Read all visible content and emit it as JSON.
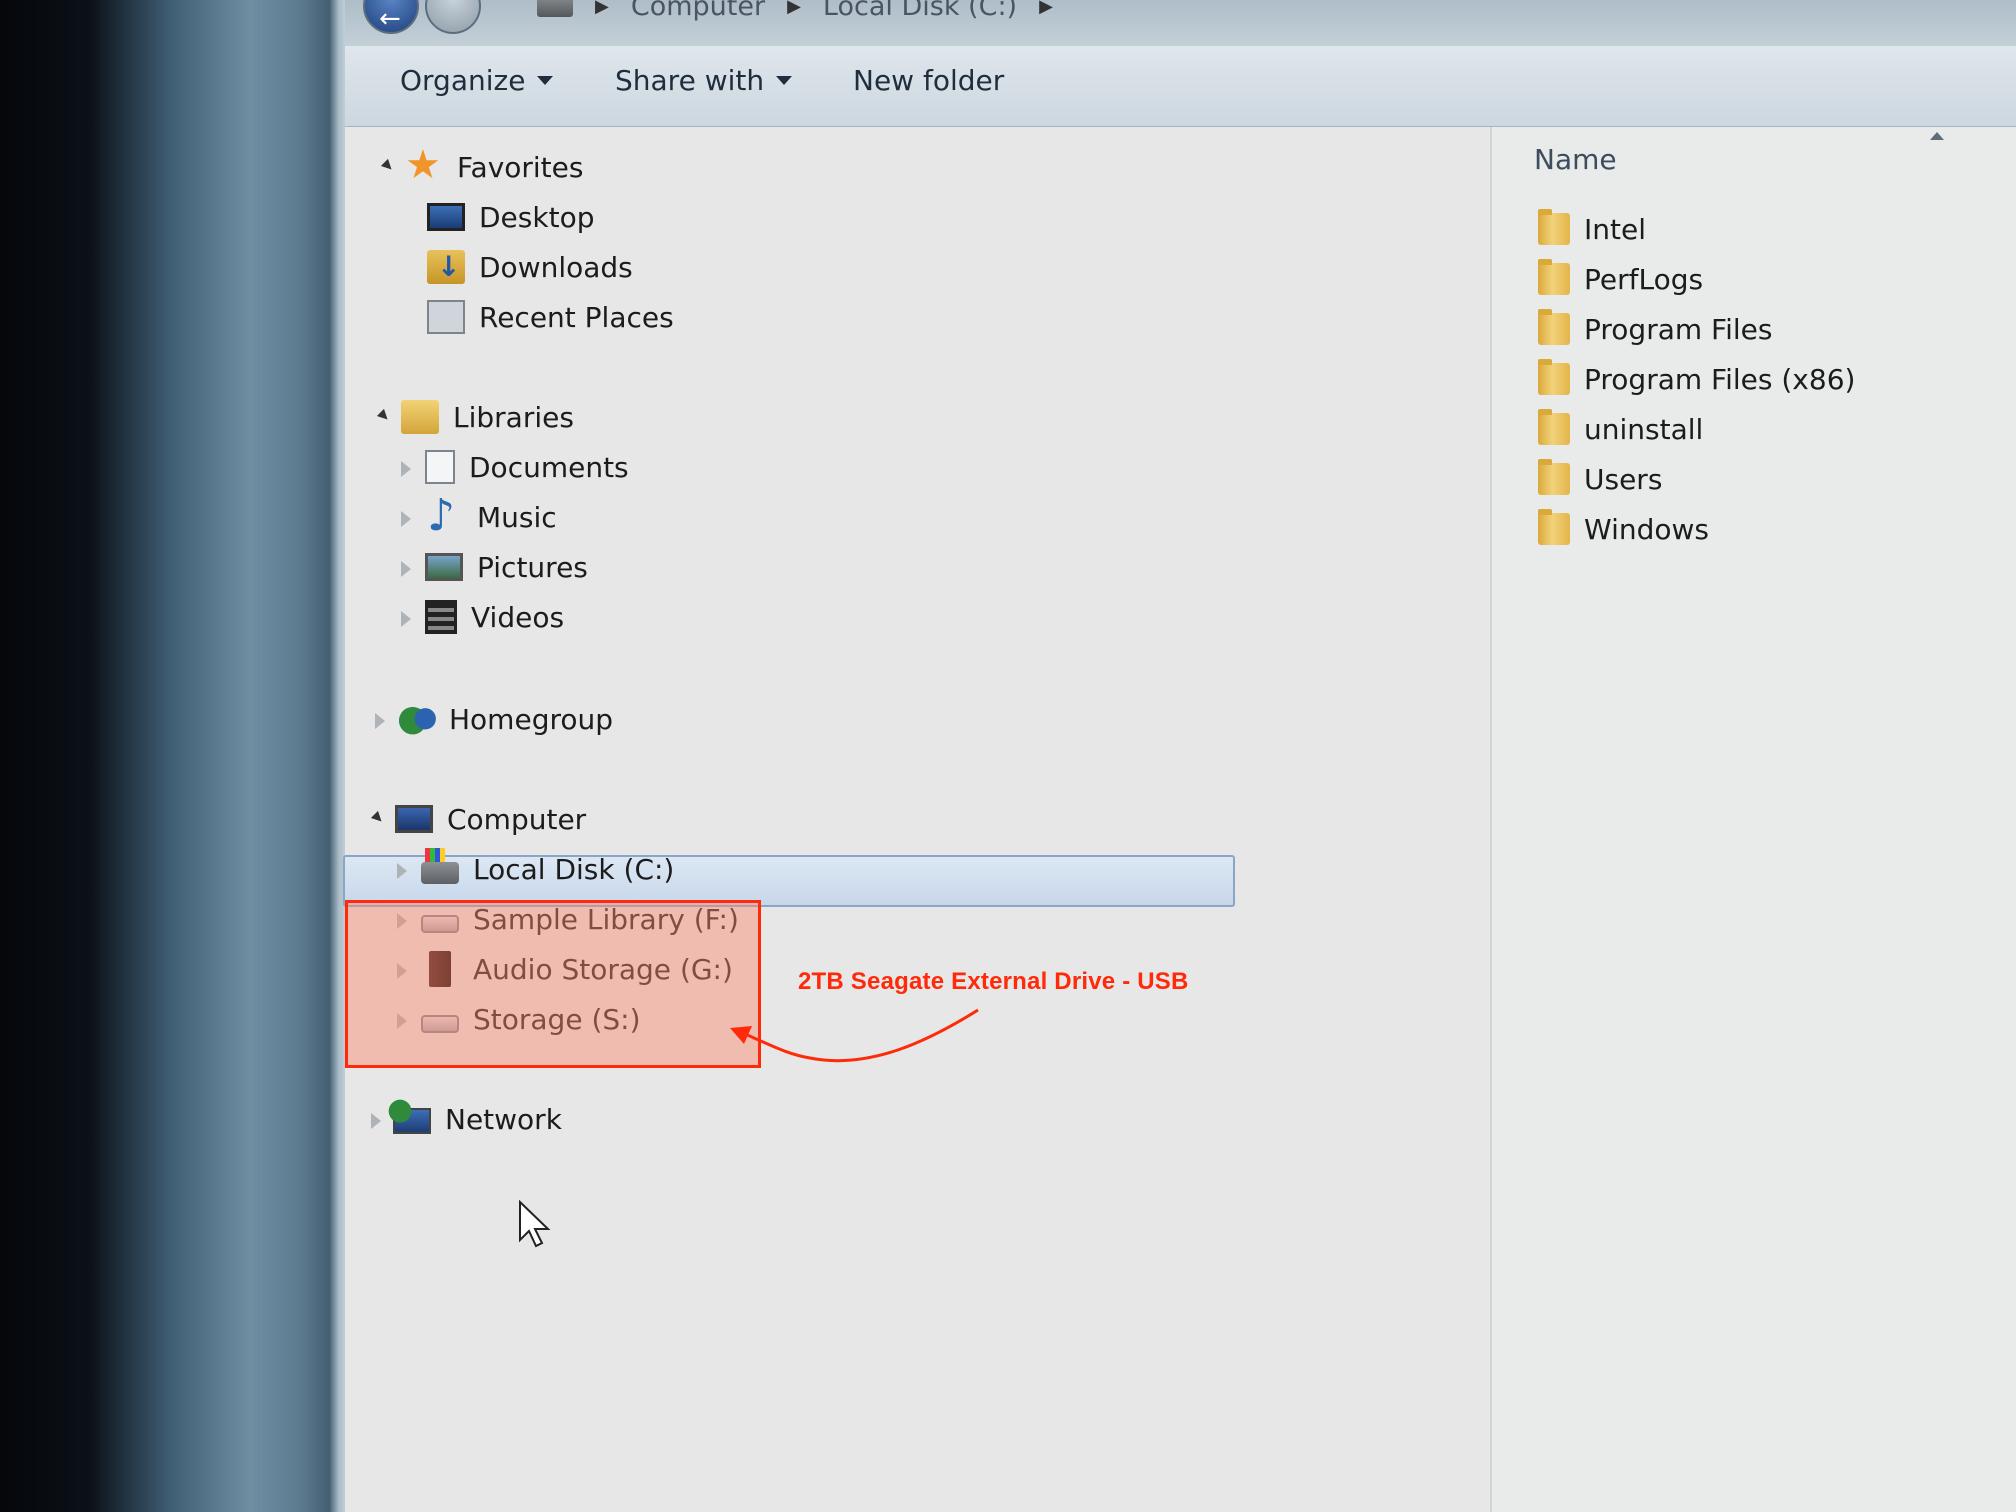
{
  "address_bar": {
    "crumbs": [
      "Computer",
      "Local Disk (C:)"
    ]
  },
  "toolbar": {
    "organize_label": "Organize",
    "share_with_label": "Share with",
    "new_folder_label": "New folder"
  },
  "nav": {
    "favorites": {
      "label": "Favorites",
      "items": [
        {
          "label": "Desktop",
          "icon": "desktop-icon"
        },
        {
          "label": "Downloads",
          "icon": "downloads-icon"
        },
        {
          "label": "Recent Places",
          "icon": "recent-places-icon"
        }
      ]
    },
    "libraries": {
      "label": "Libraries",
      "items": [
        {
          "label": "Documents",
          "icon": "documents-icon"
        },
        {
          "label": "Music",
          "icon": "music-icon"
        },
        {
          "label": "Pictures",
          "icon": "pictures-icon"
        },
        {
          "label": "Videos",
          "icon": "videos-icon"
        }
      ]
    },
    "homegroup": {
      "label": "Homegroup"
    },
    "computer": {
      "label": "Computer",
      "items": [
        {
          "label": "Local Disk (C:)",
          "icon": "local-disk-icon",
          "selected": true
        },
        {
          "label": "Sample Library (F:)",
          "icon": "drive-icon"
        },
        {
          "label": "Audio Storage (G:)",
          "icon": "external-drive-icon"
        },
        {
          "label": "Storage (S:)",
          "icon": "drive-icon"
        }
      ]
    },
    "network": {
      "label": "Network"
    }
  },
  "content": {
    "column_header": "Name",
    "files": [
      "Intel",
      "PerfLogs",
      "Program Files",
      "Program Files (x86)",
      "uninstall",
      "Users",
      "Windows"
    ]
  },
  "annotation": {
    "text": "2TB Seagate External Drive - USB",
    "color": "#ff2a0a"
  },
  "colors": {
    "selection": "#c7d7ea",
    "folder": "#e3b54a",
    "favorites_star": "#f0952a"
  }
}
